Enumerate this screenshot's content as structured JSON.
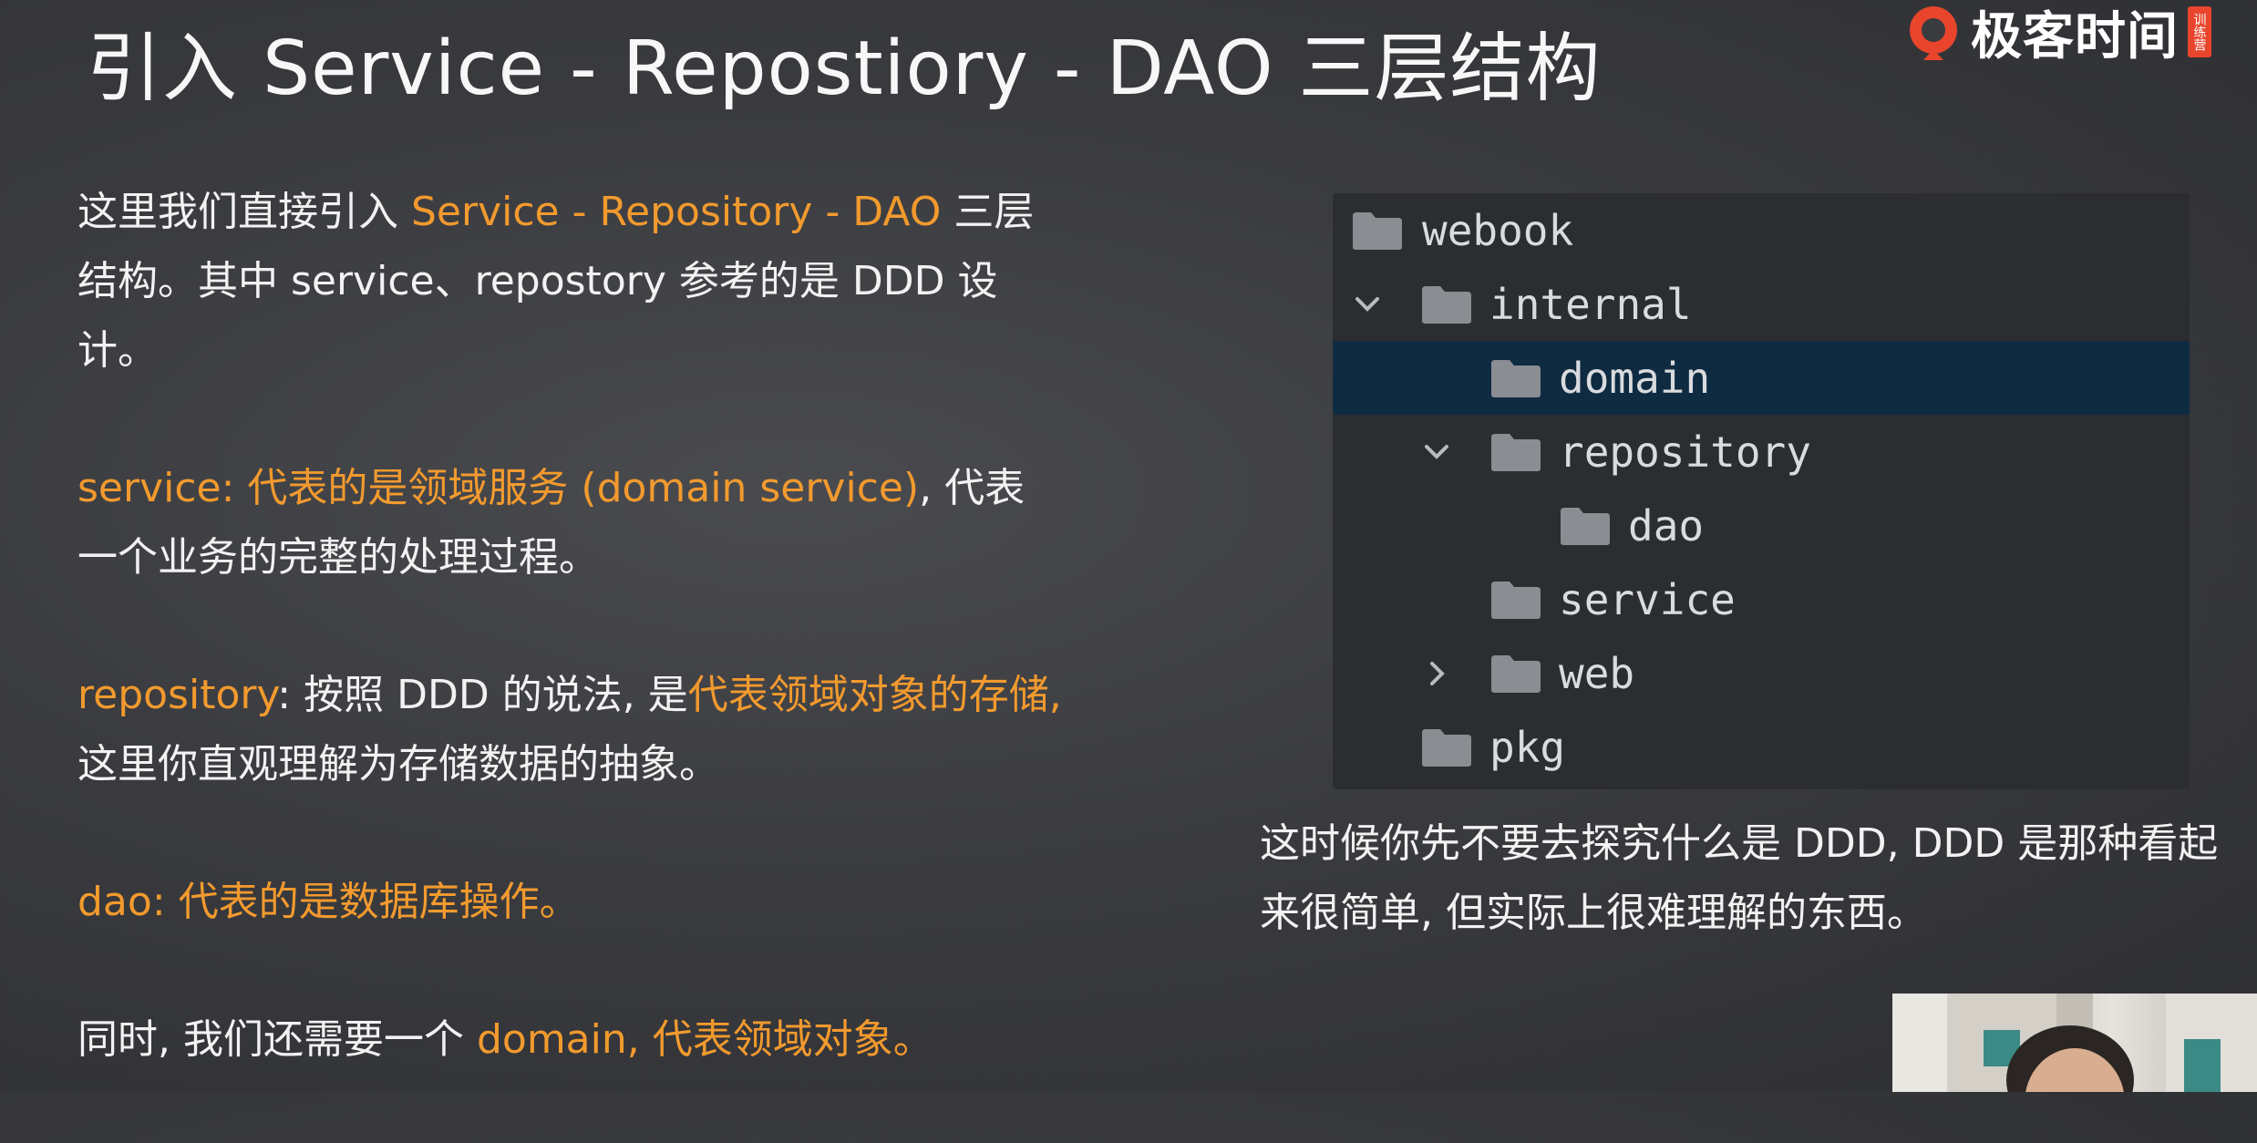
{
  "slide": {
    "title": "引入 Service - Repostiory - DAO 三层结构"
  },
  "brand": {
    "name": "极客时间",
    "badge": "训练营",
    "logo_icon": "geektime-logo-icon",
    "accent": "#e8452c"
  },
  "colors": {
    "highlight": "#f29a2e",
    "text": "#f2f2f2",
    "tree_background": "#2b2d31",
    "tree_selected": "#0f2b42",
    "folder_icon": "#8a8d92"
  },
  "intro": {
    "p1": "这里我们直接引入 ",
    "p1_hl": "Service - Repository - DAO",
    "p1_rest": " 三层结构。其中 service、repostory 参考的是 DDD 设计。"
  },
  "service_def": {
    "term": "service: 代表的是领域服务 (domain service)",
    "rest": ", 代表一个业务的完整的处理过程。"
  },
  "repository_def": {
    "term": "repository",
    "mid": ": 按照 DDD 的说法, 是",
    "term2": "代表领域对象的存储,",
    "rest": " 这里你直观理解为存储数据的抽象。"
  },
  "dao_def": {
    "text": "dao: 代表的是数据库操作。"
  },
  "domain_note": {
    "text": "同时, 我们还需要一个 ",
    "hl": "domain, 代表领域对象。"
  },
  "file_tree": {
    "items": [
      {
        "label": "webook",
        "icon": "folder-icon",
        "chevron": "",
        "depth": 0,
        "selected": false
      },
      {
        "label": "internal",
        "icon": "folder-icon",
        "chevron": "chevron-down-icon",
        "depth": 1,
        "selected": false
      },
      {
        "label": "domain",
        "icon": "folder-icon",
        "chevron": "",
        "depth": 2,
        "selected": true
      },
      {
        "label": "repository",
        "icon": "folder-icon",
        "chevron": "chevron-down-icon",
        "depth": 2,
        "selected": false
      },
      {
        "label": "dao",
        "icon": "folder-icon",
        "chevron": "",
        "depth": 3,
        "selected": false
      },
      {
        "label": "service",
        "icon": "folder-icon",
        "chevron": "",
        "depth": 2,
        "selected": false
      },
      {
        "label": "web",
        "icon": "folder-icon",
        "chevron": "chevron-right-icon",
        "depth": 2,
        "selected": false
      },
      {
        "label": "pkg",
        "icon": "folder-icon",
        "chevron": "",
        "depth": 1,
        "selected": false
      }
    ]
  },
  "caption": {
    "text": "这时候你先不要去探究什么是 DDD, DDD 是那种看起来很简单, 但实际上很难理解的东西。"
  }
}
